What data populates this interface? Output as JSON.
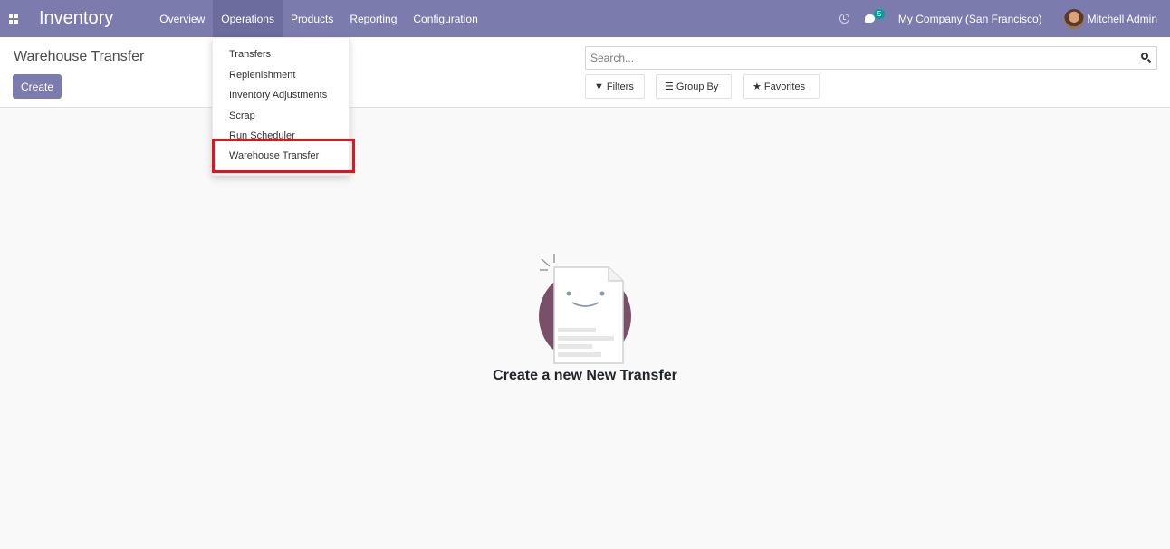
{
  "navbar": {
    "app_title": "Inventory",
    "menu": [
      "Overview",
      "Operations",
      "Products",
      "Reporting",
      "Configuration"
    ],
    "active_menu": "Operations",
    "chat_badge": "5",
    "company": "My Company (San Francisco)",
    "user_name": "Mitchell Admin"
  },
  "control_panel": {
    "title": "Warehouse Transfer",
    "create_label": "Create",
    "search_placeholder": "Search...",
    "filters_label": "Filters",
    "group_by_label": "Group By",
    "favorites_label": "Favorites"
  },
  "operations_dropdown": {
    "items": [
      "Transfers",
      "Replenishment",
      "Inventory Adjustments",
      "Scrap",
      "Run Scheduler",
      "Warehouse Transfer"
    ],
    "highlighted_item": "Warehouse Transfer"
  },
  "empty_state": {
    "message": "Create a new New Transfer"
  },
  "colors": {
    "navbar": "#7c7bad",
    "active_menu": "#6d6c9e",
    "primary_button": "#7c7bad",
    "highlight_border": "#e4141b",
    "badge": "#00a09d"
  },
  "icons": [
    "apps-grid-icon",
    "clock-icon",
    "chat-icon",
    "search-icon",
    "filter-icon",
    "list-icon",
    "star-icon"
  ]
}
